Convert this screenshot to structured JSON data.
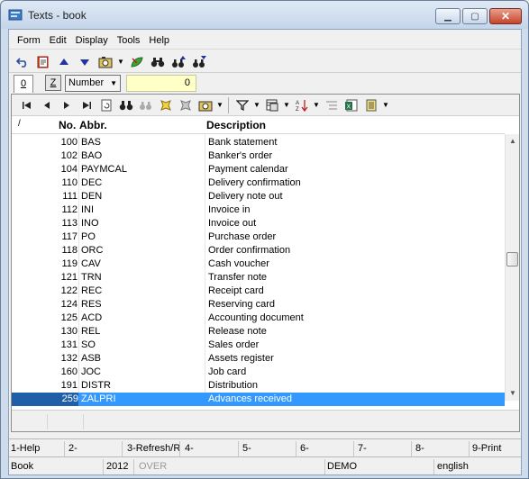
{
  "window": {
    "title": "Texts - book",
    "controls": {
      "minimize": "▁",
      "maximize": "▢",
      "close": "✕"
    }
  },
  "menu": [
    "Form",
    "Edit",
    "Display",
    "Tools",
    "Help"
  ],
  "toolbar": {
    "icons": [
      "undo-icon",
      "book-icon",
      "arrow-up-icon",
      "arrow-down-icon",
      "camera-icon",
      "leaf-icon",
      "binoculars-icon",
      "binoculars-up-icon",
      "binoculars-down-icon"
    ]
  },
  "tabs": {
    "active": "0"
  },
  "sort": {
    "z_label": "Z",
    "field": "Number",
    "search_value": "0"
  },
  "grid": {
    "columns": {
      "marker": "/",
      "no": "No.",
      "abbr": "Abbr.",
      "desc": "Description"
    },
    "rows": [
      {
        "no": "100",
        "abbr": "BAS",
        "desc": "Bank statement"
      },
      {
        "no": "102",
        "abbr": "BAO",
        "desc": "Banker's order"
      },
      {
        "no": "104",
        "abbr": "PAYMCAL",
        "desc": "Payment calendar"
      },
      {
        "no": "110",
        "abbr": "DEC",
        "desc": "Delivery confirmation"
      },
      {
        "no": "111",
        "abbr": "DEN",
        "desc": "Delivery note out"
      },
      {
        "no": "112",
        "abbr": "INI",
        "desc": "Invoice in"
      },
      {
        "no": "113",
        "abbr": "INO",
        "desc": "Invoice out"
      },
      {
        "no": "117",
        "abbr": "PO",
        "desc": "Purchase order"
      },
      {
        "no": "118",
        "abbr": "ORC",
        "desc": "Order confirmation"
      },
      {
        "no": "119",
        "abbr": "CAV",
        "desc": "Cash voucher"
      },
      {
        "no": "121",
        "abbr": "TRN",
        "desc": "Transfer note"
      },
      {
        "no": "122",
        "abbr": "REC",
        "desc": "Receipt card"
      },
      {
        "no": "124",
        "abbr": "RES",
        "desc": "Reserving card"
      },
      {
        "no": "125",
        "abbr": "ACD",
        "desc": "Accounting document"
      },
      {
        "no": "130",
        "abbr": "REL",
        "desc": "Release note"
      },
      {
        "no": "131",
        "abbr": "SO",
        "desc": "Sales order"
      },
      {
        "no": "132",
        "abbr": "ASB",
        "desc": "Assets register"
      },
      {
        "no": "160",
        "abbr": "JOC",
        "desc": "Job card"
      },
      {
        "no": "191",
        "abbr": "DISTR",
        "desc": "Distribution"
      },
      {
        "no": "259",
        "abbr": "ZALPRI",
        "desc": "Advances received"
      }
    ],
    "selected_index": 19,
    "selection_color": "#3399ff"
  },
  "fkeys": [
    "1-Help",
    "2-",
    "3-Refresh/R",
    "4-",
    "5-",
    "6-",
    "7-",
    "8-",
    "9-Print"
  ],
  "status": {
    "mode": "Book",
    "year": "2012",
    "overwrite": "OVER",
    "db": "DEMO",
    "language": "english"
  }
}
